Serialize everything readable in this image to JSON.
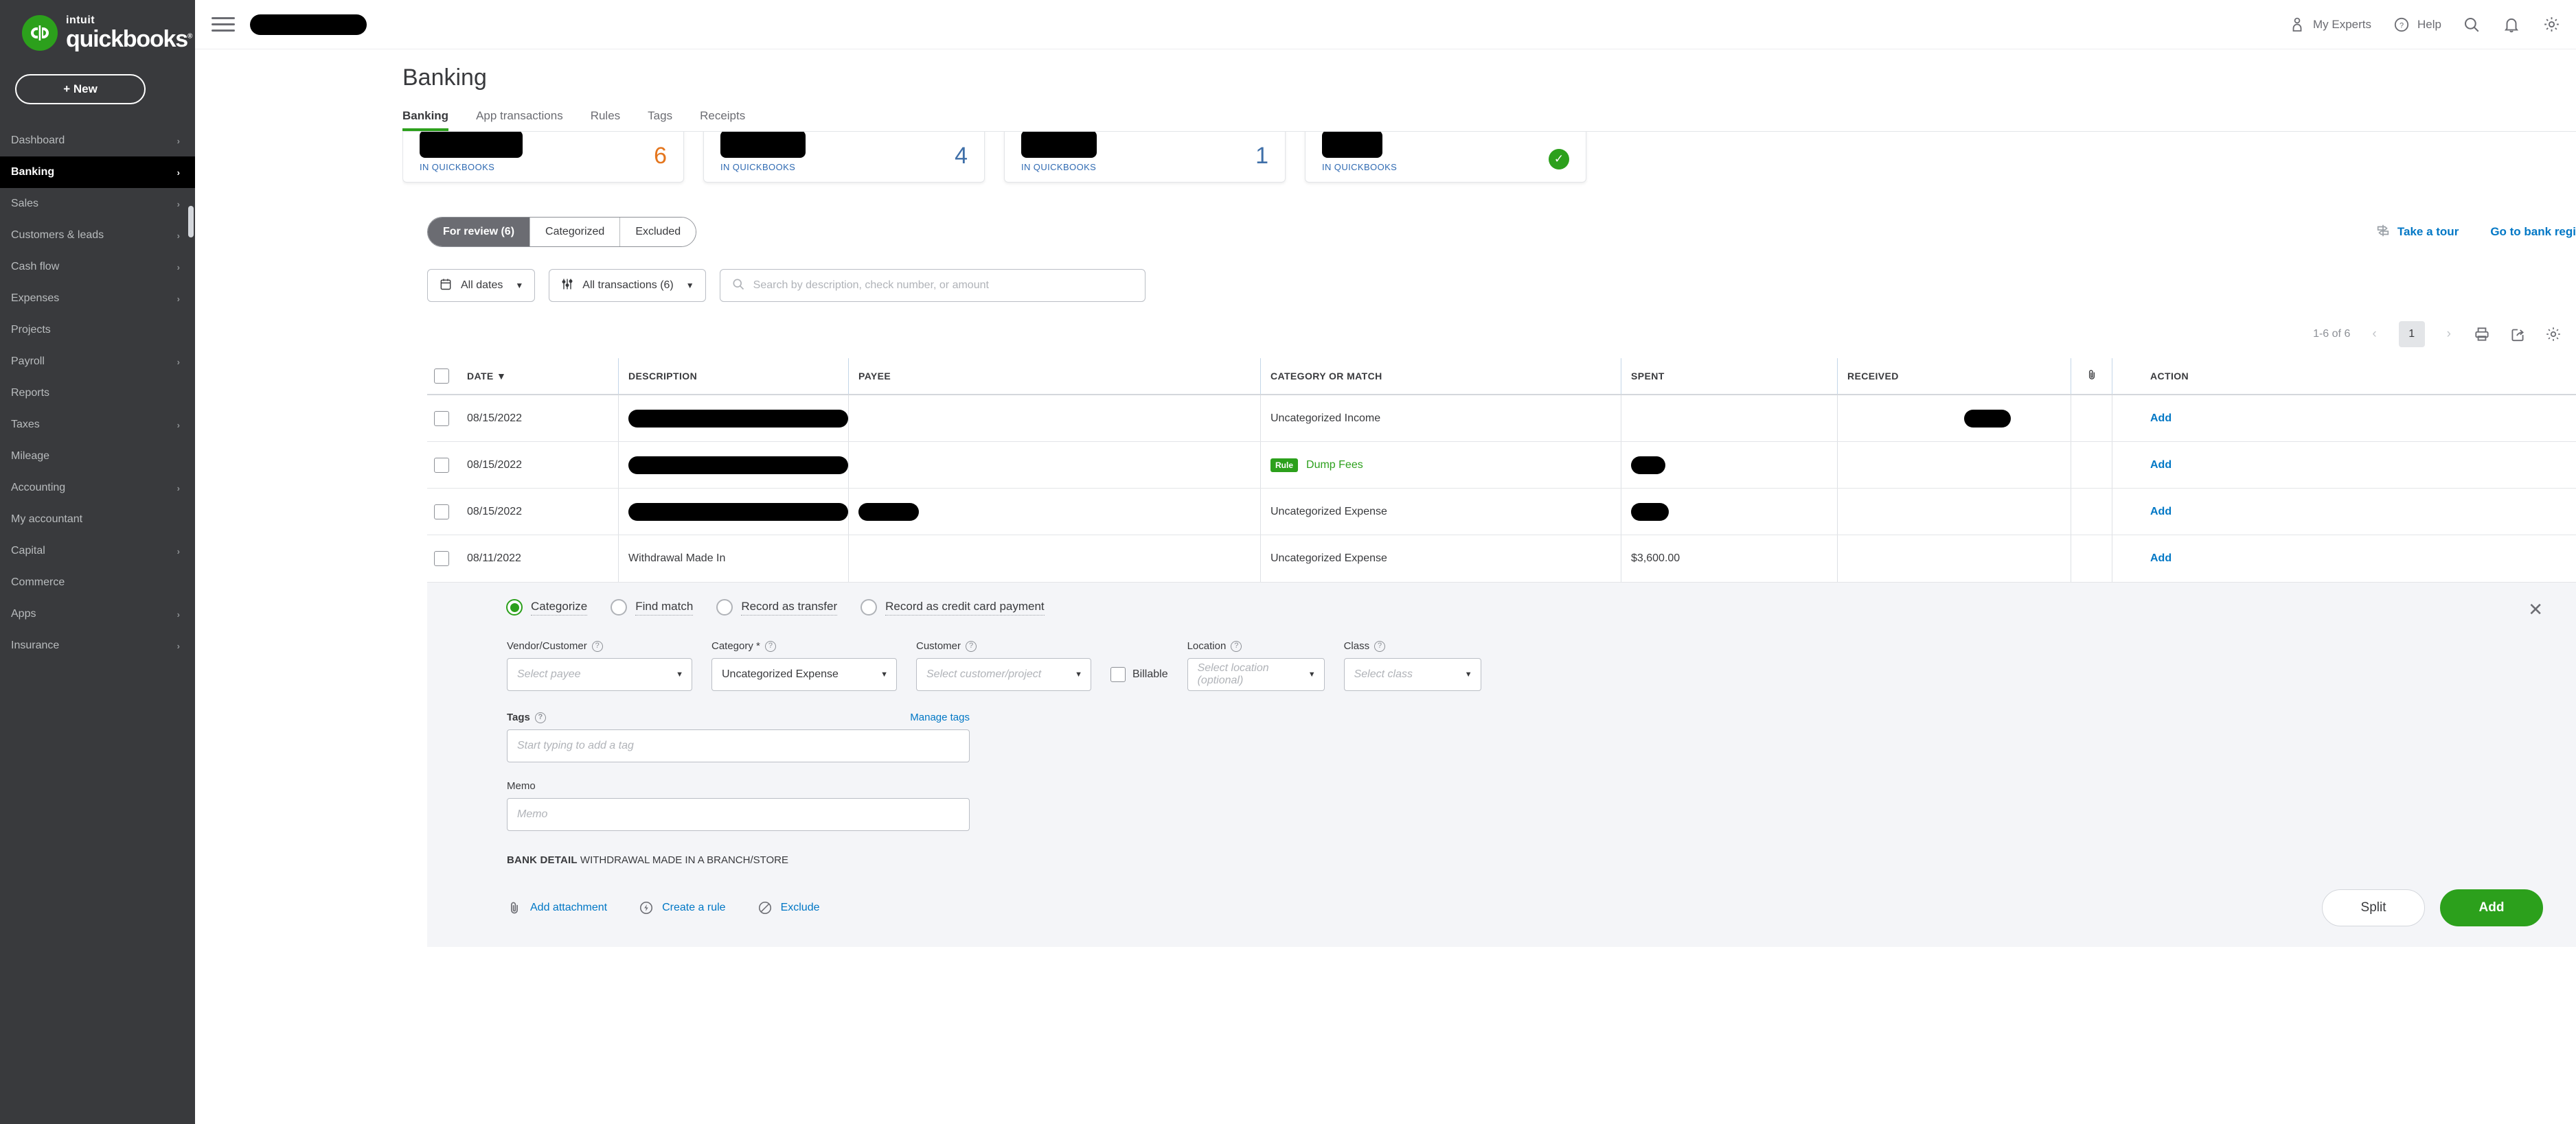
{
  "brand": {
    "intuit": "intuit",
    "name": "quickbooks",
    "accent_green": "#2ca01c",
    "link_blue": "#0077c5"
  },
  "sidebar": {
    "new_button": "+ New",
    "items": [
      {
        "label": "Dashboard",
        "chevron": true,
        "active": false
      },
      {
        "label": "Banking",
        "chevron": true,
        "active": true
      },
      {
        "label": "Sales",
        "chevron": true,
        "active": false
      },
      {
        "label": "Customers & leads",
        "chevron": true,
        "active": false
      },
      {
        "label": "Cash flow",
        "chevron": true,
        "active": false
      },
      {
        "label": "Expenses",
        "chevron": true,
        "active": false
      },
      {
        "label": "Projects",
        "chevron": false,
        "active": false
      },
      {
        "label": "Payroll",
        "chevron": true,
        "active": false
      },
      {
        "label": "Reports",
        "chevron": false,
        "active": false
      },
      {
        "label": "Taxes",
        "chevron": true,
        "active": false
      },
      {
        "label": "Mileage",
        "chevron": false,
        "active": false
      },
      {
        "label": "Accounting",
        "chevron": true,
        "active": false
      },
      {
        "label": "My accountant",
        "chevron": false,
        "active": false
      },
      {
        "label": "Capital",
        "chevron": true,
        "active": false
      },
      {
        "label": "Commerce",
        "chevron": false,
        "active": false
      },
      {
        "label": "Apps",
        "chevron": true,
        "active": false
      },
      {
        "label": "Insurance",
        "chevron": true,
        "active": false
      }
    ]
  },
  "topbar": {
    "company_name_redacted": true,
    "my_experts": "My Experts",
    "help": "Help"
  },
  "page": {
    "title": "Banking"
  },
  "tabs": [
    {
      "label": "Banking",
      "active": true
    },
    {
      "label": "App transactions",
      "active": false
    },
    {
      "label": "Rules",
      "active": false
    },
    {
      "label": "Tags",
      "active": false
    },
    {
      "label": "Receipts",
      "active": false
    }
  ],
  "accounts": [
    {
      "name_redacted": true,
      "redact_width": 150,
      "sub": "IN QUICKBOOKS",
      "count": "6",
      "count_color": "orange",
      "badge": false
    },
    {
      "name_redacted": true,
      "redact_width": 124,
      "sub": "IN QUICKBOOKS",
      "count": "4",
      "count_color": "blue",
      "badge": false
    },
    {
      "name_redacted": true,
      "redact_width": 110,
      "sub": "IN QUICKBOOKS",
      "count": "1",
      "count_color": "blue",
      "badge": false
    },
    {
      "name_redacted": true,
      "redact_width": 88,
      "sub": "IN QUICKBOOKS",
      "count": "",
      "count_color": "",
      "badge": true,
      "badge_glyph": "✓"
    }
  ],
  "review_tabs": [
    {
      "label": "For review (6)",
      "active": true
    },
    {
      "label": "Categorized",
      "active": false
    },
    {
      "label": "Excluded",
      "active": false
    }
  ],
  "header_links": {
    "take_a_tour": "Take a tour",
    "bank_register": "Go to bank regi"
  },
  "filters": {
    "date_filter": "All dates",
    "transaction_filter": "All transactions (6)",
    "search_placeholder": "Search by description, check number, or amount",
    "search_value": ""
  },
  "pagination": {
    "range": "1-6 of 6",
    "current_page": "1",
    "prev": "‹",
    "next": "›"
  },
  "table": {
    "columns": [
      "DATE",
      "DESCRIPTION",
      "PAYEE",
      "CATEGORY OR MATCH",
      "SPENT",
      "RECEIVED",
      "",
      "ACTION"
    ],
    "sort_indicator": "▼",
    "rows": [
      {
        "date": "08/15/2022",
        "desc_redacted": true,
        "desc_width": 545,
        "desc": "",
        "payee_redacted": false,
        "payee_width": 0,
        "payee": "",
        "category": "Uncategorized Income",
        "rule": false,
        "spent": "",
        "spent_redacted": false,
        "spent_width": 0,
        "received": "",
        "received_redacted": true,
        "received_width": 68,
        "action": "Add",
        "selected": false
      },
      {
        "date": "08/15/2022",
        "desc_redacted": true,
        "desc_width": 437,
        "desc": "",
        "payee_redacted": false,
        "payee_width": 0,
        "payee": "",
        "category": "Dump Fees",
        "rule": true,
        "rule_label": "Rule",
        "spent": "",
        "spent_redacted": true,
        "spent_width": 50,
        "received": "",
        "received_redacted": false,
        "received_width": 0,
        "action": "Add",
        "selected": false
      },
      {
        "date": "08/15/2022",
        "desc_redacted": true,
        "desc_width": 540,
        "desc": "",
        "payee_redacted": true,
        "payee_width": 88,
        "payee": "",
        "category": "Uncategorized Expense",
        "rule": false,
        "spent": "",
        "spent_redacted": true,
        "spent_width": 55,
        "received": "",
        "received_redacted": false,
        "received_width": 0,
        "action": "Add",
        "selected": false
      },
      {
        "date": "08/11/2022",
        "desc_redacted": false,
        "desc_width": 0,
        "desc": "Withdrawal Made In",
        "payee_redacted": false,
        "payee_width": 0,
        "payee": "",
        "category": "Uncategorized Expense",
        "rule": false,
        "spent": "$3,600.00",
        "spent_redacted": false,
        "spent_width": 0,
        "received": "",
        "received_redacted": false,
        "received_width": 0,
        "action": "Add",
        "selected": true
      }
    ]
  },
  "panel": {
    "close_glyph": "✕",
    "radio_options": [
      {
        "label": "Categorize",
        "selected": true
      },
      {
        "label": "Find match",
        "selected": false
      },
      {
        "label": "Record as transfer",
        "selected": false
      },
      {
        "label": "Record as credit card payment",
        "selected": false
      }
    ],
    "fields": {
      "vendor": {
        "label": "Vendor/Customer",
        "placeholder": "Select payee",
        "value": "",
        "help": "?"
      },
      "category": {
        "label": "Category *",
        "placeholder": "",
        "value": "Uncategorized Expense",
        "help": "?"
      },
      "customer": {
        "label": "Customer",
        "placeholder": "Select customer/project",
        "value": "",
        "help": "?"
      },
      "billable": {
        "label": "Billable",
        "checked": false
      },
      "location": {
        "label": "Location",
        "placeholder": "Select location (optional)",
        "value": "",
        "help": "?"
      },
      "class": {
        "label": "Class",
        "placeholder": "Select class",
        "value": "",
        "help": "?"
      }
    },
    "tags": {
      "label": "Tags",
      "help": "?",
      "manage_link": "Manage tags",
      "placeholder": "Start typing to add a tag",
      "value": ""
    },
    "memo": {
      "label": "Memo",
      "placeholder": "Memo",
      "value": ""
    },
    "bank_detail": {
      "label": "BANK DETAIL",
      "value": "WITHDRAWAL MADE IN A BRANCH/STORE"
    },
    "actions": [
      {
        "label": "Add attachment",
        "icon": "paperclip-icon"
      },
      {
        "label": "Create a rule",
        "icon": "bolt-icon"
      },
      {
        "label": "Exclude",
        "icon": "ban-icon"
      }
    ],
    "buttons": {
      "split": "Split",
      "add": "Add"
    }
  }
}
